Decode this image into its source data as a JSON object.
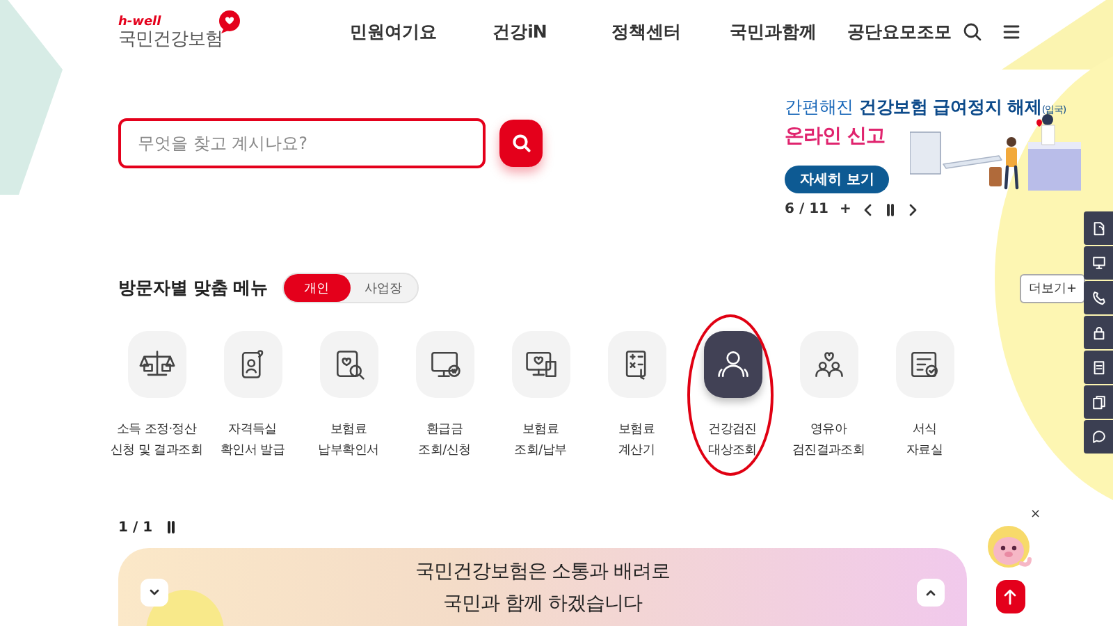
{
  "logo": {
    "tagline": "h-well",
    "name": "국민건강보험"
  },
  "nav": [
    "민원여기요",
    "건강iN",
    "정책센터",
    "국민과함께",
    "공단요모조모"
  ],
  "search": {
    "placeholder": "무엇을 찾고 계시나요?"
  },
  "promo": {
    "lead": "간편해진",
    "highlight": "건강보험 급여정지 해제",
    "note": "(입국)",
    "subtitle": "온라인 신고",
    "button": "자세히 보기",
    "counter": "6 / 11",
    "add": "+"
  },
  "quick_menu": {
    "title": "방문자별 맞춤 메뉴",
    "tabs": [
      {
        "label": "개인",
        "selected": true
      },
      {
        "label": "사업장",
        "selected": false
      }
    ],
    "more": "더보기+",
    "items": [
      {
        "lines": [
          "소득 조정·정산",
          "신청 및 결과조회"
        ],
        "selected": false,
        "circled": false
      },
      {
        "lines": [
          "자격득실",
          "확인서 발급"
        ],
        "selected": false,
        "circled": false
      },
      {
        "lines": [
          "보험료",
          "납부확인서"
        ],
        "selected": false,
        "circled": false
      },
      {
        "lines": [
          "환급금",
          "조회/신청"
        ],
        "selected": false,
        "circled": false
      },
      {
        "lines": [
          "보험료",
          "조회/납부"
        ],
        "selected": false,
        "circled": false
      },
      {
        "lines": [
          "보험료",
          "계산기"
        ],
        "selected": false,
        "circled": false
      },
      {
        "lines": [
          "건강검진",
          "대상조회"
        ],
        "selected": true,
        "circled": true
      },
      {
        "lines": [
          "영유아",
          "검진결과조회"
        ],
        "selected": false,
        "circled": false
      },
      {
        "lines": [
          "서식",
          "자료실"
        ],
        "selected": false,
        "circled": false
      }
    ]
  },
  "notice": {
    "counter": "1 / 1"
  },
  "bottom_banner": {
    "lines": [
      "국민건강보험은 소통과 배려로",
      "국민과 함께 하겠습니다"
    ]
  },
  "mascot": {
    "close": "×"
  }
}
